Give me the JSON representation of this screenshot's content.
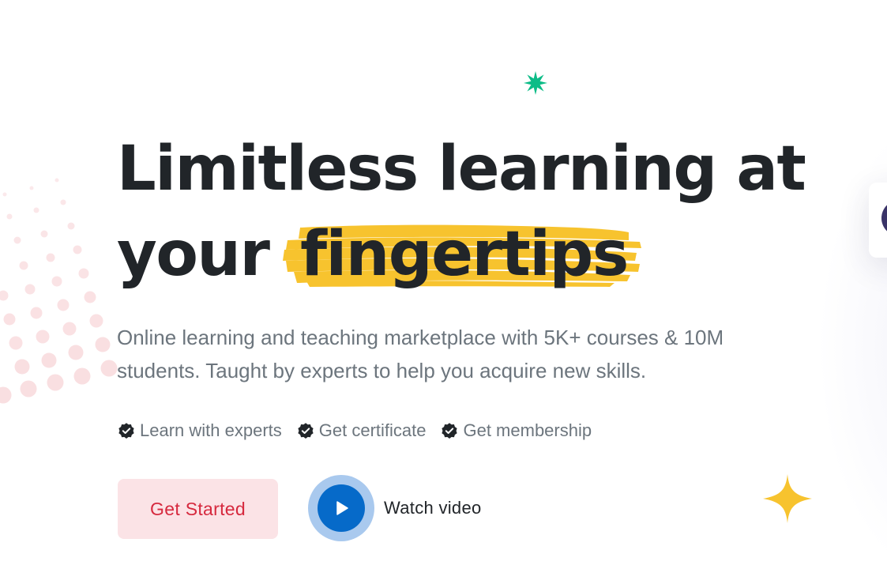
{
  "hero": {
    "headline_line1": "Limitless learning at",
    "headline_line2_prefix": "your",
    "headline_highlight": "fingertips",
    "subtitle": "Online learning and teaching marketplace with 5K+ courses & 10M students. Taught by experts to help you acquire new skills.",
    "features": [
      {
        "label": "Learn with experts",
        "icon": "verified-check-icon"
      },
      {
        "label": "Get certificate",
        "icon": "verified-check-icon"
      },
      {
        "label": "Get membership",
        "icon": "verified-check-icon"
      }
    ],
    "cta_label": "Get Started",
    "watch_label": "Watch video"
  },
  "decorations": {
    "star_icon": "green-star-icon",
    "sparkle_icon": "yellow-sparkle-icon",
    "play_icon": "play-icon"
  },
  "colors": {
    "headline": "#212529",
    "highlight": "#f7c32e",
    "text_muted": "#6c757d",
    "cta_bg": "#fbe3e6",
    "cta_text": "#d6293e",
    "play_primary": "#066ac9",
    "play_ring": "#a9c9ee",
    "star_green": "#0cbc87",
    "dots": "#f8d7da"
  }
}
